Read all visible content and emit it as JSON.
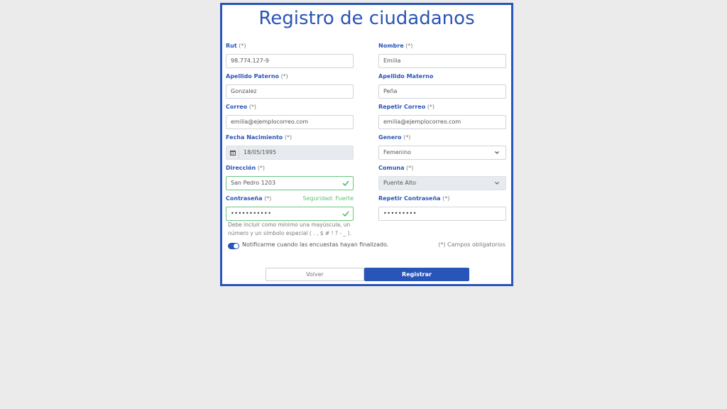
{
  "form": {
    "title": "Registro de ciudadanos",
    "required_mark": "(*)",
    "fields": {
      "rut": {
        "label": "Rut",
        "value": "98.774.127-9"
      },
      "nombre": {
        "label": "Nombre",
        "value": "Emilia"
      },
      "apellido_paterno": {
        "label": "Apellido Paterno",
        "value": "Gonzalez"
      },
      "apellido_materno": {
        "label": "Apellido Materno",
        "value": "Peña"
      },
      "correo": {
        "label": "Correo",
        "value": "emilia@ejemplocorreo.com"
      },
      "repetir_correo": {
        "label": "Repetir Correo",
        "value": "emilia@ejemplocorreo.com"
      },
      "fecha_nacimiento": {
        "label": "Fecha Nacimiento",
        "value": "18/05/1995"
      },
      "genero": {
        "label": "Genero",
        "value": "Femenino"
      },
      "direccion": {
        "label": "Dirección",
        "value": "San Pedro 1203"
      },
      "comuna": {
        "label": "Comuna",
        "value": "Puente Alto"
      },
      "contrasena": {
        "label": "Contraseña",
        "value": "•••••••••••",
        "strength": "Seguridad: Fuerte"
      },
      "repetir_contrasena": {
        "label": "Repetir Contraseña",
        "value": "•••••••••"
      }
    },
    "password_help": "Debe incluir como mínimo una mayúscula, un número y un símbolo especial ( . , $ # ! ? - _ ).",
    "notify_label": "Notificarme cuando las encuestas hayan finalizado.",
    "notify_enabled": true,
    "required_note": "(*) Campos obligatorios",
    "buttons": {
      "back": "Volver",
      "submit": "Registrar"
    }
  },
  "colors": {
    "accent": "#2a55b8",
    "valid": "#5cc073",
    "background": "#ebebeb"
  },
  "icons": {
    "calendar": "calendar-icon",
    "check": "check-icon",
    "chevron": "chevron-down-icon"
  }
}
